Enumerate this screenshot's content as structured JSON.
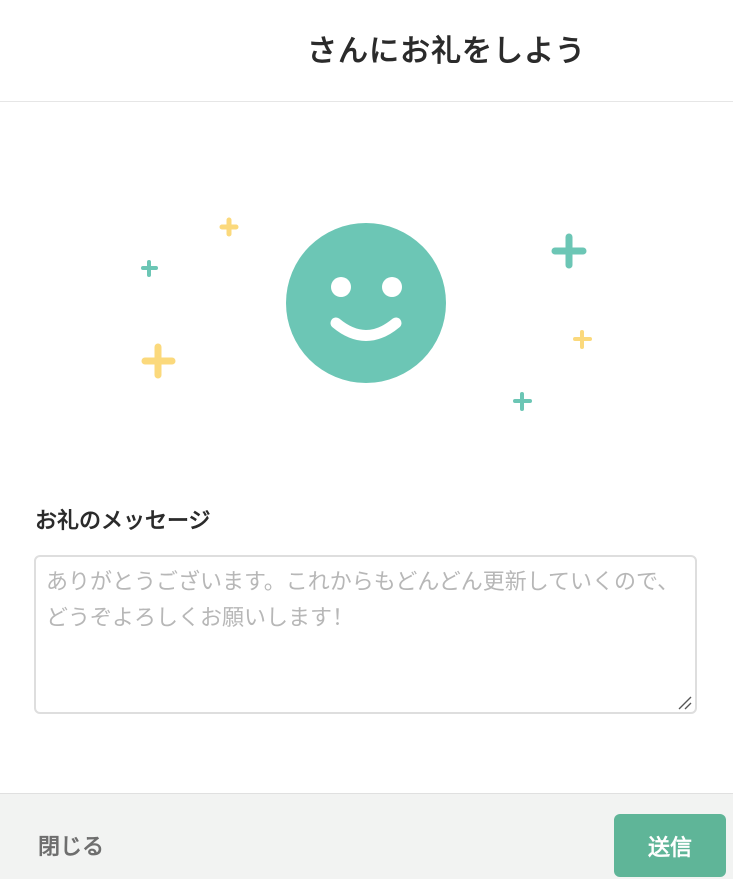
{
  "header": {
    "title": "さんにお礼をしよう"
  },
  "illustration": {
    "face_color": "#6cc6b5",
    "sparkle_teal": "#6cc6b5",
    "sparkle_yellow": "#fbd97c",
    "icon": "smiley-face-icon"
  },
  "form": {
    "label": "お礼のメッセージ",
    "placeholder": "ありがとうございます。これからもどんどん更新していくので、どうぞよろしくお願いします！",
    "value": ""
  },
  "footer": {
    "close_label": "閉じる",
    "send_label": "送信",
    "send_color": "#5fb598"
  }
}
